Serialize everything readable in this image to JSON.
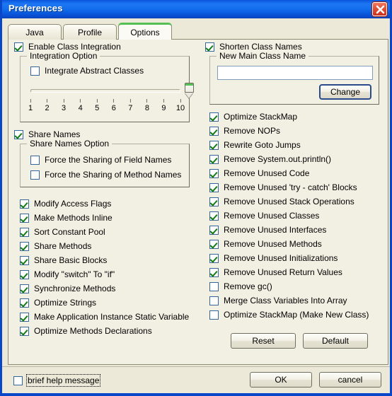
{
  "window": {
    "title": "Preferences",
    "close_icon": "close-icon",
    "accent_titlebar": "#1470ee",
    "accent_active_tab": "#54c054",
    "accent_check": "#127a12",
    "background": "#ece9d8"
  },
  "tabs": [
    {
      "label": "Java",
      "active": false
    },
    {
      "label": "Profile",
      "active": false
    },
    {
      "label": "Options",
      "active": true
    }
  ],
  "left_column": {
    "enable_class_integration": {
      "label": "Enable Class Integration",
      "checked": true
    },
    "integration_option": {
      "title": "Integration Option",
      "integrate_abstract_classes": {
        "label": "Integrate Abstract Classes",
        "checked": false
      },
      "slider": {
        "value": 10,
        "min": 1,
        "max": 10,
        "ticks": [
          "1",
          "2",
          "3",
          "4",
          "5",
          "6",
          "7",
          "8",
          "9",
          "10"
        ]
      }
    },
    "share_names": {
      "label": "Share Names",
      "checked": true
    },
    "share_names_option": {
      "title": "Share Names Option",
      "items": [
        {
          "label": "Force the Sharing of Field Names",
          "checked": false
        },
        {
          "label": "Force the Sharing of Method Names",
          "checked": false
        }
      ]
    },
    "options": [
      {
        "label": "Modify Access Flags",
        "checked": true
      },
      {
        "label": "Make Methods Inline",
        "checked": true
      },
      {
        "label": "Sort Constant Pool",
        "checked": true
      },
      {
        "label": "Share Methods",
        "checked": true
      },
      {
        "label": "Share Basic Blocks",
        "checked": true
      },
      {
        "label": "Modify \"switch\" To \"if\"",
        "checked": true
      },
      {
        "label": "Synchronize Methods",
        "checked": true
      },
      {
        "label": "Optimize Strings",
        "checked": true
      },
      {
        "label": "Make Application Instance Static Variable",
        "checked": true
      },
      {
        "label": "Optimize Methods Declarations",
        "checked": true
      }
    ]
  },
  "right_column": {
    "shorten_class_names": {
      "label": "Shorten Class Names",
      "checked": true
    },
    "new_main_class_name": {
      "title": "New Main Class Name",
      "value": "",
      "placeholder": "",
      "change_button": "Change"
    },
    "options": [
      {
        "label": "Optimize StackMap",
        "checked": true
      },
      {
        "label": "Remove NOPs",
        "checked": true
      },
      {
        "label": "Rewrite Goto Jumps",
        "checked": true
      },
      {
        "label": "Remove System.out.println()",
        "checked": true
      },
      {
        "label": "Remove Unused Code",
        "checked": true
      },
      {
        "label": "Remove Unused 'try - catch' Blocks",
        "checked": true
      },
      {
        "label": "Remove Unused Stack Operations",
        "checked": true
      },
      {
        "label": "Remove Unused Classes",
        "checked": true
      },
      {
        "label": "Remove Unused Interfaces",
        "checked": true
      },
      {
        "label": "Remove Unused Methods",
        "checked": true
      },
      {
        "label": "Remove Unused Initializations",
        "checked": true
      },
      {
        "label": "Remove Unused Return Values",
        "checked": true
      },
      {
        "label": "Remove gc()",
        "checked": false
      },
      {
        "label": "Merge Class Variables Into Array",
        "checked": false
      },
      {
        "label": "Optimize StackMap (Make New Class)",
        "checked": false
      }
    ],
    "reset_button": "Reset",
    "default_button": "Default"
  },
  "footer": {
    "brief_help_message": {
      "label": "brief help message",
      "checked": false
    },
    "ok_button": "OK",
    "cancel_button": "cancel"
  }
}
